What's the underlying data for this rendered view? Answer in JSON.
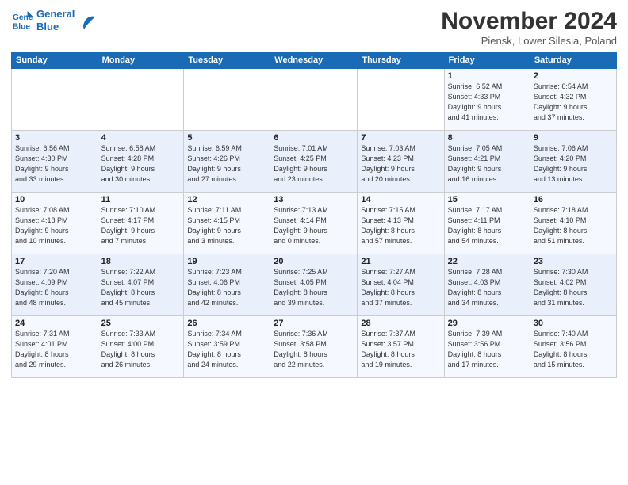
{
  "logo": {
    "line1": "General",
    "line2": "Blue"
  },
  "title": "November 2024",
  "subtitle": "Piensk, Lower Silesia, Poland",
  "headers": [
    "Sunday",
    "Monday",
    "Tuesday",
    "Wednesday",
    "Thursday",
    "Friday",
    "Saturday"
  ],
  "weeks": [
    [
      {
        "day": "",
        "info": ""
      },
      {
        "day": "",
        "info": ""
      },
      {
        "day": "",
        "info": ""
      },
      {
        "day": "",
        "info": ""
      },
      {
        "day": "",
        "info": ""
      },
      {
        "day": "1",
        "info": "Sunrise: 6:52 AM\nSunset: 4:33 PM\nDaylight: 9 hours\nand 41 minutes."
      },
      {
        "day": "2",
        "info": "Sunrise: 6:54 AM\nSunset: 4:32 PM\nDaylight: 9 hours\nand 37 minutes."
      }
    ],
    [
      {
        "day": "3",
        "info": "Sunrise: 6:56 AM\nSunset: 4:30 PM\nDaylight: 9 hours\nand 33 minutes."
      },
      {
        "day": "4",
        "info": "Sunrise: 6:58 AM\nSunset: 4:28 PM\nDaylight: 9 hours\nand 30 minutes."
      },
      {
        "day": "5",
        "info": "Sunrise: 6:59 AM\nSunset: 4:26 PM\nDaylight: 9 hours\nand 27 minutes."
      },
      {
        "day": "6",
        "info": "Sunrise: 7:01 AM\nSunset: 4:25 PM\nDaylight: 9 hours\nand 23 minutes."
      },
      {
        "day": "7",
        "info": "Sunrise: 7:03 AM\nSunset: 4:23 PM\nDaylight: 9 hours\nand 20 minutes."
      },
      {
        "day": "8",
        "info": "Sunrise: 7:05 AM\nSunset: 4:21 PM\nDaylight: 9 hours\nand 16 minutes."
      },
      {
        "day": "9",
        "info": "Sunrise: 7:06 AM\nSunset: 4:20 PM\nDaylight: 9 hours\nand 13 minutes."
      }
    ],
    [
      {
        "day": "10",
        "info": "Sunrise: 7:08 AM\nSunset: 4:18 PM\nDaylight: 9 hours\nand 10 minutes."
      },
      {
        "day": "11",
        "info": "Sunrise: 7:10 AM\nSunset: 4:17 PM\nDaylight: 9 hours\nand 7 minutes."
      },
      {
        "day": "12",
        "info": "Sunrise: 7:11 AM\nSunset: 4:15 PM\nDaylight: 9 hours\nand 3 minutes."
      },
      {
        "day": "13",
        "info": "Sunrise: 7:13 AM\nSunset: 4:14 PM\nDaylight: 9 hours\nand 0 minutes."
      },
      {
        "day": "14",
        "info": "Sunrise: 7:15 AM\nSunset: 4:13 PM\nDaylight: 8 hours\nand 57 minutes."
      },
      {
        "day": "15",
        "info": "Sunrise: 7:17 AM\nSunset: 4:11 PM\nDaylight: 8 hours\nand 54 minutes."
      },
      {
        "day": "16",
        "info": "Sunrise: 7:18 AM\nSunset: 4:10 PM\nDaylight: 8 hours\nand 51 minutes."
      }
    ],
    [
      {
        "day": "17",
        "info": "Sunrise: 7:20 AM\nSunset: 4:09 PM\nDaylight: 8 hours\nand 48 minutes."
      },
      {
        "day": "18",
        "info": "Sunrise: 7:22 AM\nSunset: 4:07 PM\nDaylight: 8 hours\nand 45 minutes."
      },
      {
        "day": "19",
        "info": "Sunrise: 7:23 AM\nSunset: 4:06 PM\nDaylight: 8 hours\nand 42 minutes."
      },
      {
        "day": "20",
        "info": "Sunrise: 7:25 AM\nSunset: 4:05 PM\nDaylight: 8 hours\nand 39 minutes."
      },
      {
        "day": "21",
        "info": "Sunrise: 7:27 AM\nSunset: 4:04 PM\nDaylight: 8 hours\nand 37 minutes."
      },
      {
        "day": "22",
        "info": "Sunrise: 7:28 AM\nSunset: 4:03 PM\nDaylight: 8 hours\nand 34 minutes."
      },
      {
        "day": "23",
        "info": "Sunrise: 7:30 AM\nSunset: 4:02 PM\nDaylight: 8 hours\nand 31 minutes."
      }
    ],
    [
      {
        "day": "24",
        "info": "Sunrise: 7:31 AM\nSunset: 4:01 PM\nDaylight: 8 hours\nand 29 minutes."
      },
      {
        "day": "25",
        "info": "Sunrise: 7:33 AM\nSunset: 4:00 PM\nDaylight: 8 hours\nand 26 minutes."
      },
      {
        "day": "26",
        "info": "Sunrise: 7:34 AM\nSunset: 3:59 PM\nDaylight: 8 hours\nand 24 minutes."
      },
      {
        "day": "27",
        "info": "Sunrise: 7:36 AM\nSunset: 3:58 PM\nDaylight: 8 hours\nand 22 minutes."
      },
      {
        "day": "28",
        "info": "Sunrise: 7:37 AM\nSunset: 3:57 PM\nDaylight: 8 hours\nand 19 minutes."
      },
      {
        "day": "29",
        "info": "Sunrise: 7:39 AM\nSunset: 3:56 PM\nDaylight: 8 hours\nand 17 minutes."
      },
      {
        "day": "30",
        "info": "Sunrise: 7:40 AM\nSunset: 3:56 PM\nDaylight: 8 hours\nand 15 minutes."
      }
    ]
  ]
}
